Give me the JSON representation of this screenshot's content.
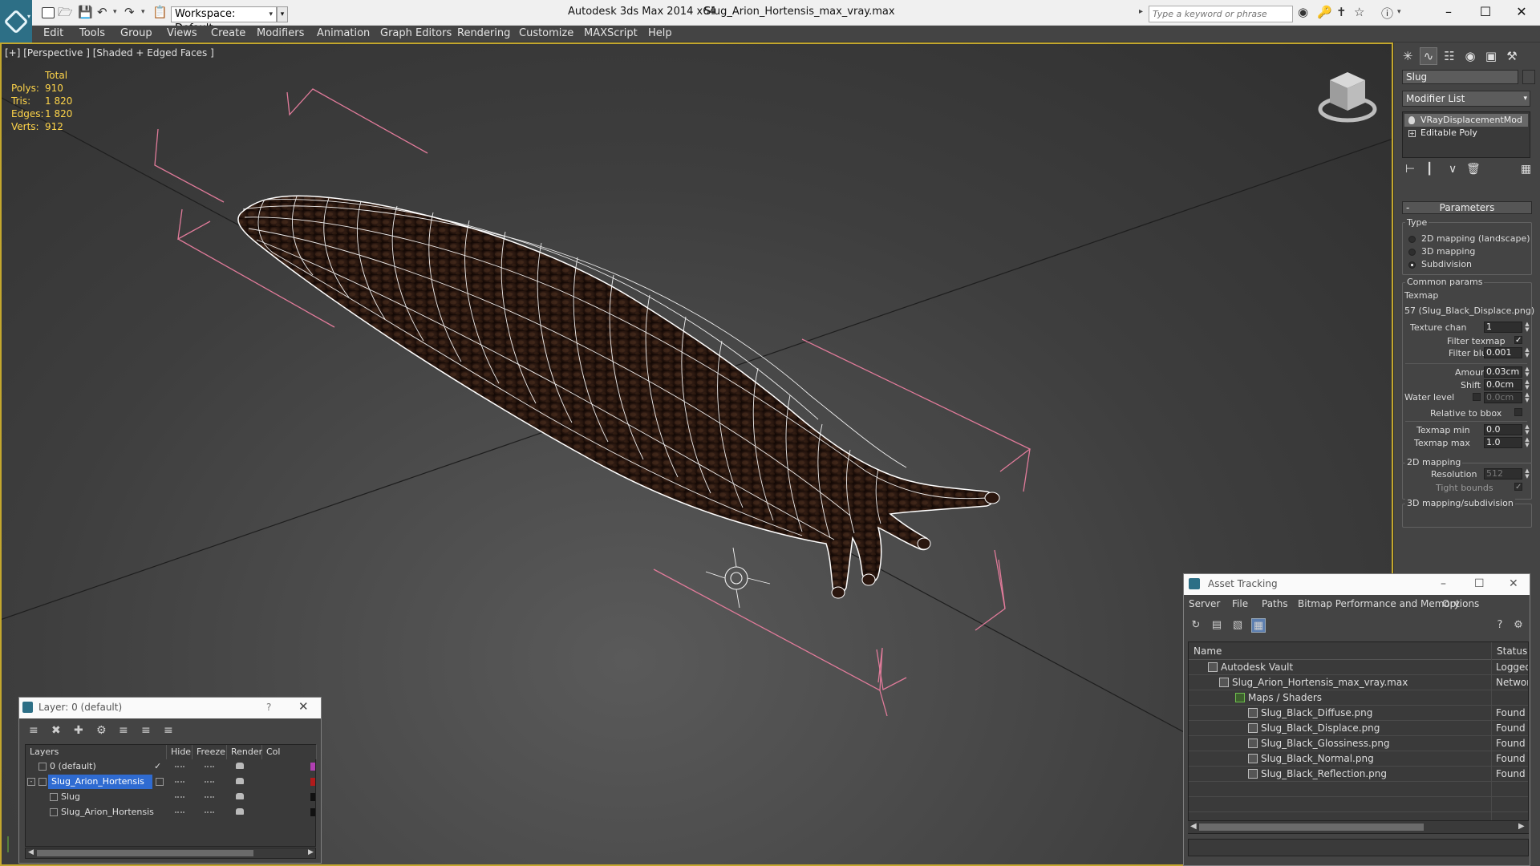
{
  "titlebar": {
    "workspace": "Workspace: Default",
    "app_title": "Autodesk 3ds Max  2014 x64",
    "file_title": "Slug_Arion_Hortensis_max_vray.max",
    "search_placeholder": "Type a keyword or phrase"
  },
  "menu": [
    "Edit",
    "Tools",
    "Group",
    "Views",
    "Create",
    "Modifiers",
    "Animation",
    "Graph Editors",
    "Rendering",
    "Customize",
    "MAXScript",
    "Help"
  ],
  "viewport": {
    "label": "[+] [Perspective ] [Shaded + Edged Faces ]",
    "stats_header": "Total",
    "stats": [
      {
        "label": "Polys:",
        "value": "910"
      },
      {
        "label": "Tris:",
        "value": "1 820"
      },
      {
        "label": "Edges:",
        "value": "1 820"
      },
      {
        "label": "Verts:",
        "value": "912"
      }
    ]
  },
  "command_panel": {
    "object_name": "Slug",
    "modifier_list": "Modifier List",
    "stack": [
      {
        "label": "VRayDisplacementMod",
        "selected": true
      },
      {
        "label": "Editable Poly",
        "selected": false
      }
    ],
    "rollout_title": "Parameters",
    "type_label": "Type",
    "type_options": [
      {
        "label": "2D mapping (landscape)",
        "on": false
      },
      {
        "label": "3D mapping",
        "on": false
      },
      {
        "label": "Subdivision",
        "on": true
      }
    ],
    "common_params_label": "Common params",
    "texmap_label": "Texmap",
    "texmap_value": "57 (Slug_Black_Displace.png)",
    "texture_chan_label": "Texture chan",
    "texture_chan_value": "1",
    "filter_texmap_label": "Filter texmap",
    "filter_blur_label": "Filter blur",
    "filter_blur_value": "0.001",
    "amount_label": "Amount",
    "amount_value": "0.03cm",
    "shift_label": "Shift",
    "shift_value": "0.0cm",
    "water_level_label": "Water level",
    "water_level_value": "0.0cm",
    "relative_bbox_label": "Relative to bbox",
    "texmap_min_label": "Texmap min",
    "texmap_min_value": "0.0",
    "texmap_max_label": "Texmap max",
    "texmap_max_value": "1.0",
    "mapping2d_label": "2D mapping",
    "resolution_label": "Resolution",
    "resolution_value": "512",
    "tight_bounds_label": "Tight bounds",
    "mapping3d_label": "3D mapping/subdivision"
  },
  "layer_manager": {
    "title": "Layer: 0 (default)",
    "help": "?",
    "columns": [
      "Layers",
      "Hide",
      "Freeze",
      "Render",
      "Col"
    ],
    "rows": [
      {
        "name": "0 (default)",
        "color": "#b13fb3"
      },
      {
        "name": "Slug_Arion_Hortensis",
        "color": "#b21b1b"
      },
      {
        "name": "Slug",
        "color": "#111111"
      },
      {
        "name": "Slug_Arion_Hortensis",
        "color": "#111111"
      }
    ]
  },
  "asset_tracking": {
    "title": "Asset Tracking",
    "menu": [
      "Server",
      "File",
      "Paths",
      "Bitmap Performance and Memory",
      "Options"
    ],
    "columns": [
      "Name",
      "Status"
    ],
    "rows": [
      {
        "name": "Autodesk Vault",
        "status": "Logged Out"
      },
      {
        "name": "Slug_Arion_Hortensis_max_vray.max",
        "status": "Network Path"
      },
      {
        "name": "Maps / Shaders",
        "status": ""
      },
      {
        "name": "Slug_Black_Diffuse.png",
        "status": "Found"
      },
      {
        "name": "Slug_Black_Displace.png",
        "status": "Found"
      },
      {
        "name": "Slug_Black_Glossiness.png",
        "status": "Found"
      },
      {
        "name": "Slug_Black_Normal.png",
        "status": "Found"
      },
      {
        "name": "Slug_Black_Reflection.png",
        "status": "Found"
      }
    ]
  },
  "colors": {
    "viewport_border": "#c3a72e",
    "stats_text": "#ffd54a",
    "bbox_lines": "#e07b9a",
    "wireframe": "#ffffff",
    "slug_body": "#2e1a12",
    "selection": "#2f6bd1"
  }
}
